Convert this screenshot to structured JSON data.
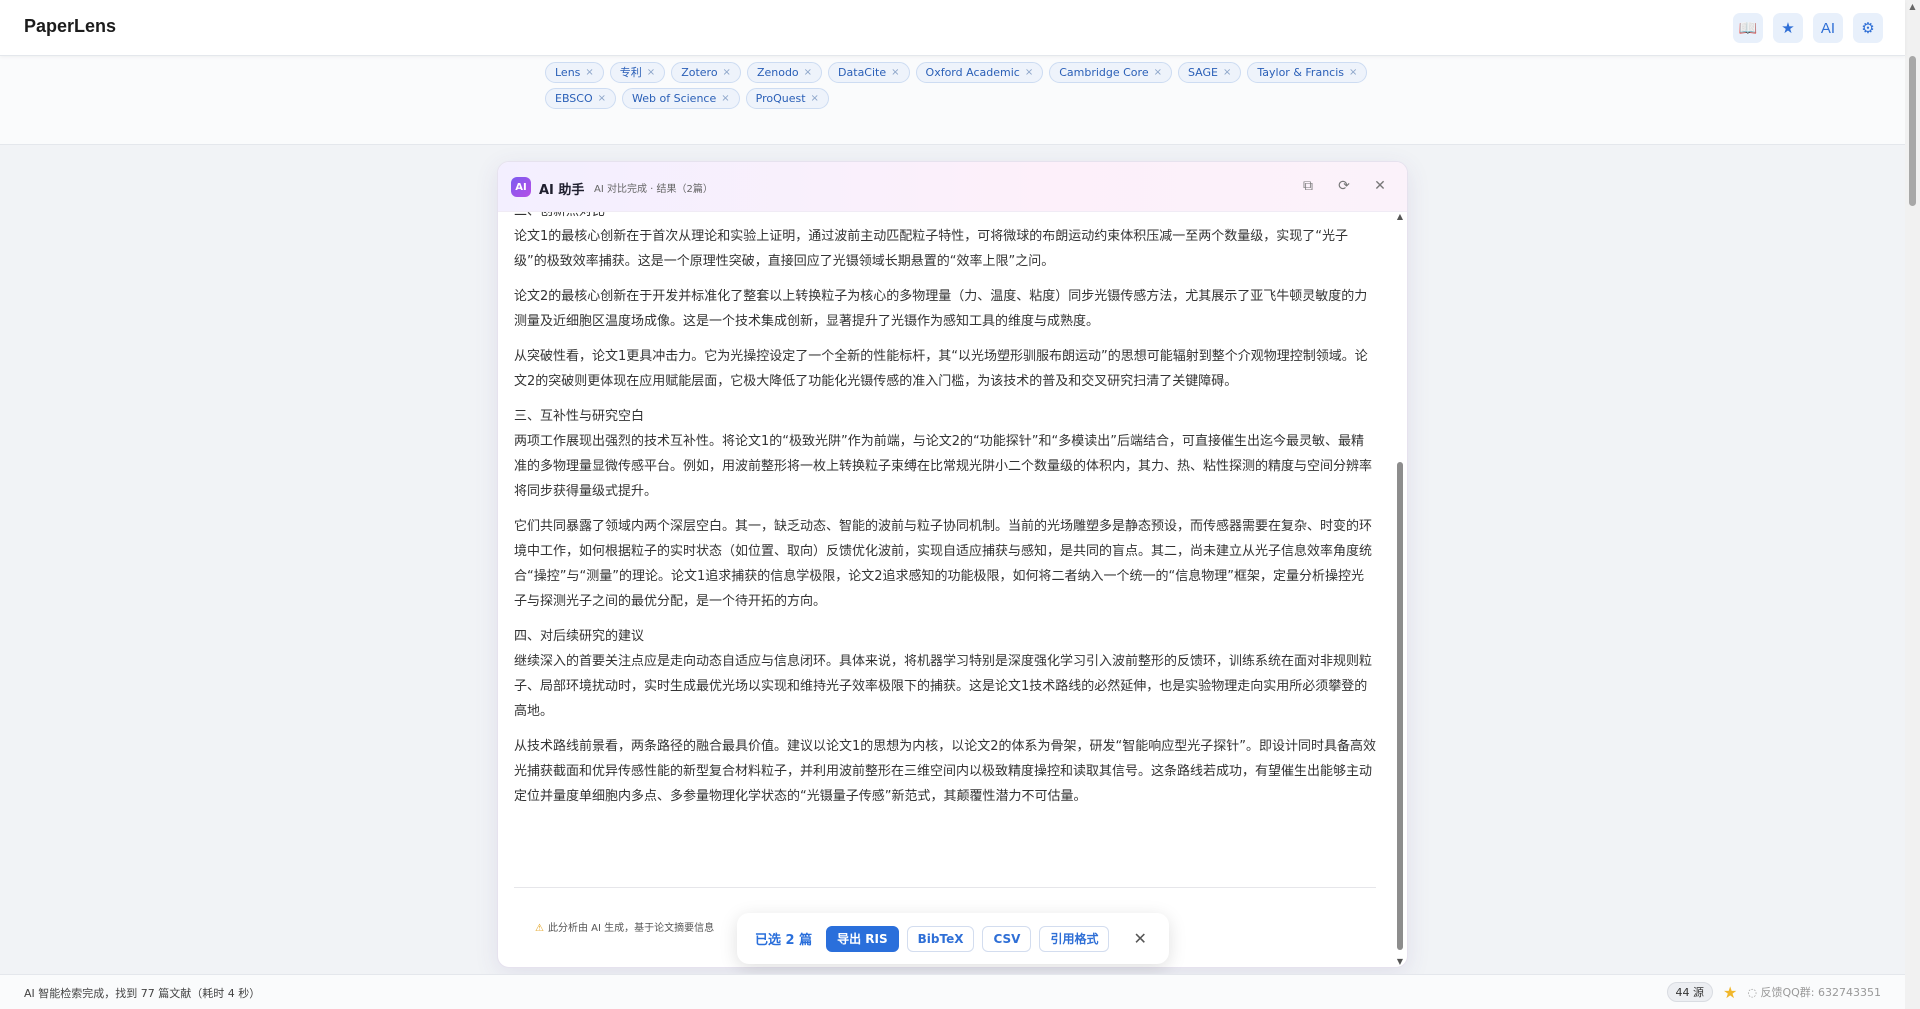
{
  "app": {
    "name": "PaperLens"
  },
  "top_actions": [
    {
      "name": "book-icon",
      "glyph": "📖"
    },
    {
      "name": "star-icon",
      "glyph": "★"
    },
    {
      "name": "ai-icon",
      "glyph": "AI"
    },
    {
      "name": "gear-icon",
      "glyph": "⚙"
    }
  ],
  "filter_tags": {
    "row1": [
      "Lens",
      "专利",
      "Zotero",
      "Zenodo",
      "DataCite",
      "Oxford Academic",
      "Cambridge Core",
      "SAGE",
      "Taylor & Francis"
    ],
    "row2": [
      "EBSCO",
      "Web of Science",
      "ProQuest"
    ]
  },
  "ai_panel": {
    "badge": "AI",
    "title": "AI 助手",
    "status": "AI 对比完成 · 结果（2篇）",
    "tools": {
      "copy": "⧉",
      "refresh": "⟳",
      "close": "✕"
    },
    "cut_line": "二、创新点对比",
    "paragraphs": [
      "论文1的最核心创新在于首次从理论和实验上证明，通过波前主动匹配粒子特性，可将微球的布朗运动约束体积压减一至两个数量级，实现了“光子级”的极致效率捕获。这是一个原理性突破，直接回应了光镊领域长期悬置的“效率上限”之问。",
      "论文2的最核心创新在于开发并标准化了整套以上转换粒子为核心的多物理量（力、温度、粘度）同步光镊传感方法，尤其展示了亚飞牛顿灵敏度的力测量及近细胞区温度场成像。这是一个技术集成创新，显著提升了光镊作为感知工具的维度与成熟度。",
      "从突破性看，论文1更具冲击力。它为光操控设定了一个全新的性能标杆，其“以光场塑形驯服布朗运动”的思想可能辐射到整个介观物理控制领域。论文2的突破则更体现在应用赋能层面，它极大降低了功能化光镊传感的准入门槛，为该技术的普及和交叉研究扫清了关键障碍。"
    ],
    "heading3": "三、互补性与研究空白",
    "paragraphs3": [
      "两项工作展现出强烈的技术互补性。将论文1的“极致光阱”作为前端，与论文2的“功能探针”和“多模读出”后端结合，可直接催生出迄今最灵敏、最精准的多物理量显微传感平台。例如，用波前整形将一枚上转换粒子束缚在比常规光阱小二个数量级的体积内，其力、热、粘性探测的精度与空间分辨率将同步获得量级式提升。",
      "它们共同暴露了领域内两个深层空白。其一，缺乏动态、智能的波前与粒子协同机制。当前的光场雕塑多是静态预设，而传感器需要在复杂、时变的环境中工作，如何根据粒子的实时状态（如位置、取向）反馈优化波前，实现自适应捕获与感知，是共同的盲点。其二，尚未建立从光子信息效率角度统合“操控”与“测量”的理论。论文1追求捕获的信息学极限，论文2追求感知的功能极限，如何将二者纳入一个统一的“信息物理”框架，定量分析操控光子与探测光子之间的最优分配，是一个待开拓的方向。"
    ],
    "heading4": "四、对后续研究的建议",
    "paragraphs4": [
      "继续深入的首要关注点应是走向动态自适应与信息闭环。具体来说，将机器学习特别是深度强化学习引入波前整形的反馈环，训练系统在面对非规则粒子、局部环境扰动时，实时生成最优光场以实现和维持光子效率极限下的捕获。这是论文1技术路线的必然延伸，也是实验物理走向实用所必须攀登的高地。",
      "从技术路线前景看，两条路径的融合最具价值。建议以论文1的思想为内核，以论文2的体系为骨架，研发“智能响应型光子探针”。即设计同时具备高效光捕获截面和优异传感性能的新型复合材料粒子，并利用波前整形在三维空间内以极致精度操控和读取其信号。这条路线若成功，有望催生出能够主动定位并量度单细胞内多点、多参量物理化学状态的“光镊量子传感”新范式，其颠覆性潜力不可估量。"
    ],
    "disclaimer": "此分析由 AI 生成，基于论文摘要信息"
  },
  "selection_bar": {
    "count_label": "已选 2 篇",
    "export_ris": "导出 RIS",
    "bibtex": "BibTeX",
    "csv": "CSV",
    "cite_format": "引用格式",
    "close": "✕"
  },
  "status_bar": {
    "text": "AI 智能检索完成，找到 77 篇文献（耗时 4 秒）",
    "sources": "44 源",
    "feedback": "◌ 反馈QQ群: 632743351"
  },
  "colors": {
    "accent": "#2a6fdb",
    "ai_gradient_start": "#7b5cf0",
    "ai_gradient_end": "#b64ee6"
  }
}
